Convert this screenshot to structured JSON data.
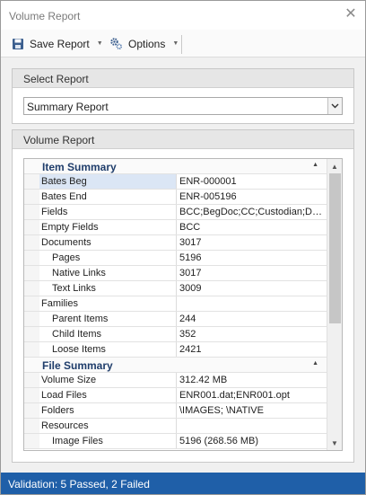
{
  "window": {
    "title": "Volume Report"
  },
  "toolbar": {
    "save_label": "Save Report",
    "options_label": "Options"
  },
  "select_report": {
    "header": "Select Report",
    "selected": "Summary Report"
  },
  "volume_report": {
    "header": "Volume Report",
    "categories": [
      {
        "label": "Item Summary",
        "rows": [
          {
            "name": "Bates Beg",
            "value": "ENR-000001",
            "level": 1,
            "selected": true
          },
          {
            "name": "Bates End",
            "value": "ENR-005196",
            "level": 1
          },
          {
            "name": "Fields",
            "value": "BCC;BegDoc;CC;Custodian;DateCreated",
            "level": 1
          },
          {
            "name": "Empty Fields",
            "value": "BCC",
            "level": 1
          },
          {
            "name": "Documents",
            "value": "3017",
            "level": 1
          },
          {
            "name": "Pages",
            "value": "5196",
            "level": 2
          },
          {
            "name": "Native Links",
            "value": "3017",
            "level": 2
          },
          {
            "name": "Text Links",
            "value": "3009",
            "level": 2
          },
          {
            "name": "Families",
            "value": "",
            "level": 1
          },
          {
            "name": "Parent Items",
            "value": "244",
            "level": 2
          },
          {
            "name": "Child Items",
            "value": "352",
            "level": 2
          },
          {
            "name": "Loose Items",
            "value": "2421",
            "level": 2
          }
        ]
      },
      {
        "label": "File Summary",
        "rows": [
          {
            "name": "Volume Size",
            "value": "312.42 MB",
            "level": 1
          },
          {
            "name": "Load Files",
            "value": "ENR001.dat;ENR001.opt",
            "level": 1
          },
          {
            "name": "Folders",
            "value": "\\IMAGES; \\NATIVE",
            "level": 1
          },
          {
            "name": "Resources",
            "value": "",
            "level": 1
          },
          {
            "name": "Image Files",
            "value": "5196 (268.56 MB)",
            "level": 2
          }
        ]
      }
    ],
    "scroll_position": 0.0,
    "visible_fraction": 0.6
  },
  "status": {
    "text": "Validation: 5 Passed, 2 Failed"
  },
  "colors": {
    "status_bar": "#1f5fa8",
    "category_text": "#1f3d6b",
    "selection": "#dbe6f5"
  }
}
